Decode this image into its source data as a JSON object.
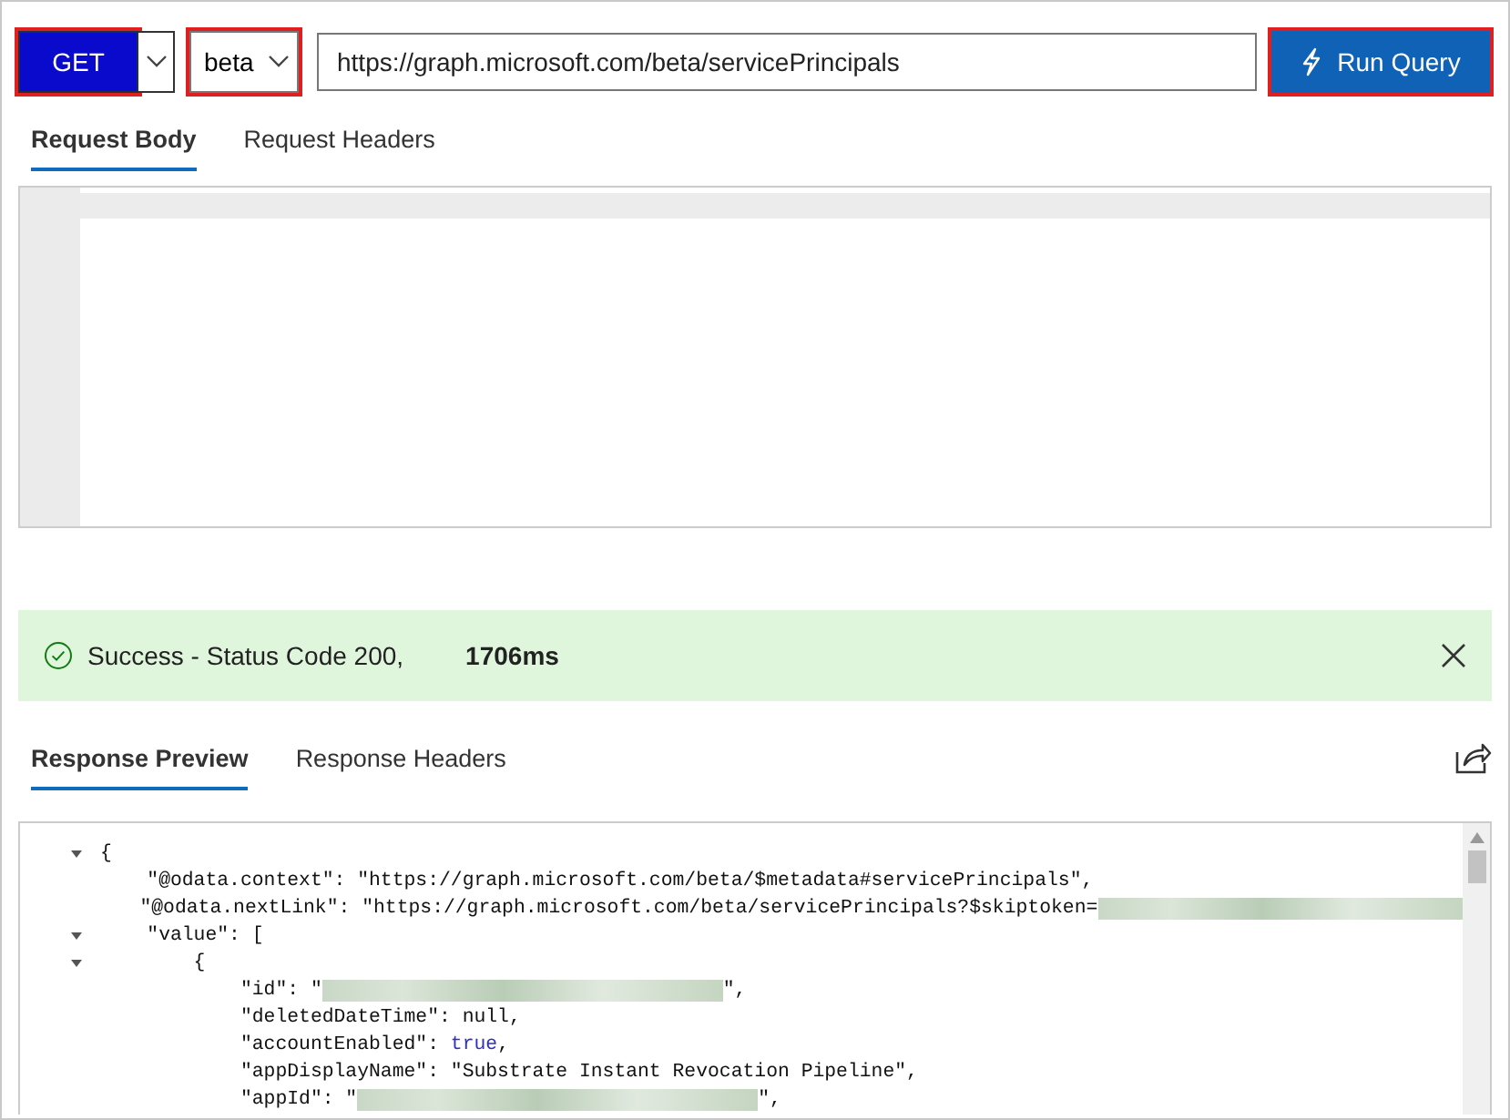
{
  "request": {
    "method": {
      "label": "GET",
      "highlighted": true
    },
    "version": {
      "label": "beta",
      "highlighted": true
    },
    "url": {
      "value": "https://graph.microsoft.com/beta/servicePrincipals"
    },
    "run_button": {
      "label": "Run Query",
      "highlighted": true
    }
  },
  "request_tabs": [
    {
      "label": "Request Body",
      "selected": true
    },
    {
      "label": "Request Headers",
      "selected": false
    }
  ],
  "status": {
    "message": "Success - Status Code 200,",
    "duration": "1706ms"
  },
  "response_tabs": [
    {
      "label": "Response Preview",
      "selected": true
    },
    {
      "label": "Response Headers",
      "selected": false
    }
  ],
  "response_lines": [
    {
      "fold": true,
      "segments": [
        {
          "kind": "text",
          "text": "{"
        }
      ]
    },
    {
      "fold": false,
      "segments": [
        {
          "kind": "text",
          "text": "    \"@odata.context\": \"https://graph.microsoft.com/beta/$metadata#servicePrincipals\","
        }
      ]
    },
    {
      "fold": false,
      "segments": [
        {
          "kind": "text",
          "text": "    \"@odata.nextLink\": \"https://graph.microsoft.com/beta/servicePrincipals?$skiptoken="
        },
        {
          "kind": "redacted"
        }
      ]
    },
    {
      "fold": true,
      "segments": [
        {
          "kind": "text",
          "text": "    \"value\": ["
        }
      ]
    },
    {
      "fold": true,
      "segments": [
        {
          "kind": "text",
          "text": "        {"
        }
      ]
    },
    {
      "fold": false,
      "segments": [
        {
          "kind": "text",
          "text": "            \"id\": \""
        },
        {
          "kind": "redacted"
        },
        {
          "kind": "text",
          "text": "\","
        }
      ]
    },
    {
      "fold": false,
      "segments": [
        {
          "kind": "text",
          "text": "            \"deletedDateTime\": null,"
        }
      ]
    },
    {
      "fold": false,
      "segments": [
        {
          "kind": "text",
          "text": "            \"accountEnabled\": "
        },
        {
          "kind": "keyword",
          "text": "true"
        },
        {
          "kind": "text",
          "text": ","
        }
      ]
    },
    {
      "fold": false,
      "segments": [
        {
          "kind": "text",
          "text": "            \"appDisplayName\": \"Substrate Instant Revocation Pipeline\","
        }
      ]
    },
    {
      "fold": false,
      "segments": [
        {
          "kind": "text",
          "text": "            \"appId\": \""
        },
        {
          "kind": "redacted"
        },
        {
          "kind": "text",
          "text": "\","
        }
      ]
    }
  ]
}
